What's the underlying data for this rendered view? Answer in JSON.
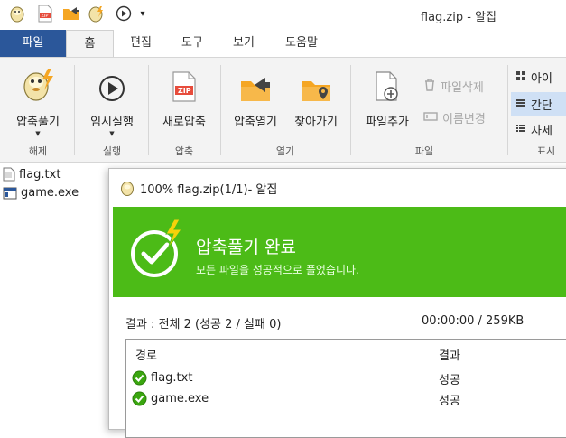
{
  "window": {
    "title": "flag.zip - 알집"
  },
  "quick_access": [
    "alzip-logo-icon",
    "new-zip-icon",
    "open-folder-icon",
    "extract-icon",
    "play-icon",
    "dropdown-icon"
  ],
  "ribbon_tabs": {
    "file": "파일",
    "home": "홈",
    "edit": "편집",
    "tools": "도구",
    "view": "보기",
    "help": "도움말"
  },
  "ribbon": {
    "extract": {
      "label": "압축풀기",
      "group": "해제"
    },
    "run": {
      "label": "임시실행",
      "group": "실행"
    },
    "new_zip": {
      "label": "새로압축",
      "group": "압축"
    },
    "open_zip": {
      "label": "압축열기"
    },
    "find": {
      "label": "찾아가기"
    },
    "open_group": "열기",
    "add_file": {
      "label": "파일추가"
    },
    "delete_file": {
      "label": "파일삭제"
    },
    "rename": {
      "label": "이름변경"
    },
    "file_group": "파일",
    "view_icon": {
      "label": "아이"
    },
    "view_simple": {
      "label": "간단"
    },
    "view_detail": {
      "label": "자세"
    },
    "display_group": "표시"
  },
  "file_list": [
    {
      "name": "flag.txt",
      "icon": "text-file-icon"
    },
    {
      "name": "game.exe",
      "icon": "exe-file-icon"
    }
  ],
  "dialog": {
    "title": "100% flag.zip(1/1)- 알집",
    "banner_title": "압축풀기 완료",
    "banner_subtitle": "모든 파일을 성공적으로 풀었습니다.",
    "summary": "결과 : 전체 2 (성공 2 / 실패 0)",
    "time_size": "00:00:00 / 259KB",
    "col_path": "경로",
    "col_result": "결과",
    "rows": [
      {
        "path": "flag.txt",
        "result": "성공"
      },
      {
        "path": "game.exe",
        "result": "성공"
      }
    ]
  },
  "colors": {
    "banner": "#4cbb17",
    "file_tab": "#2b579a",
    "accent_orange": "#f5a623"
  }
}
